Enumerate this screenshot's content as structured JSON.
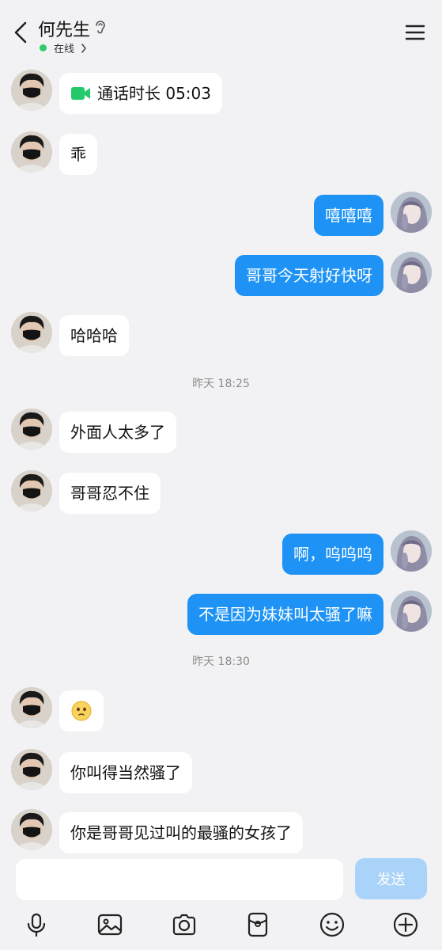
{
  "header": {
    "title": "何先生",
    "status": "在线"
  },
  "messages": [
    {
      "side": "left",
      "type": "call",
      "text": "通话时长 05:03",
      "icon": "video-call-icon"
    },
    {
      "side": "left",
      "type": "text",
      "text": "乖"
    },
    {
      "side": "right",
      "type": "text",
      "text": "嘻嘻嘻"
    },
    {
      "side": "right",
      "type": "text",
      "text": "哥哥今天射好快呀"
    },
    {
      "side": "left",
      "type": "text",
      "text": "哈哈哈"
    },
    {
      "type": "time",
      "text": "昨天 18:25"
    },
    {
      "side": "left",
      "type": "text",
      "text": "外面人太多了"
    },
    {
      "side": "left",
      "type": "text",
      "text": "哥哥忍不住"
    },
    {
      "side": "right",
      "type": "text",
      "text": "啊，呜呜呜"
    },
    {
      "side": "right",
      "type": "text",
      "text": "不是因为妹妹叫太骚了嘛"
    },
    {
      "type": "time",
      "text": "昨天 18:30"
    },
    {
      "side": "left",
      "type": "emoji",
      "icon": "thinking-face-emoji"
    },
    {
      "side": "left",
      "type": "text",
      "text": "你叫得当然骚了"
    },
    {
      "side": "left",
      "type": "text",
      "text": "你是哥哥见过叫的最骚的女孩了"
    }
  ],
  "input": {
    "placeholder": "",
    "send_label": "发送"
  },
  "toolbar": [
    "microphone-icon",
    "image-icon",
    "camera-icon",
    "red-packet-icon",
    "emoji-icon",
    "plus-icon"
  ],
  "colors": {
    "background": "#f2f2f4",
    "bubble_self": "#1e93f5",
    "bubble_other": "#ffffff",
    "online": "#2ccb6e",
    "send_disabled": "#a9d3f8"
  }
}
